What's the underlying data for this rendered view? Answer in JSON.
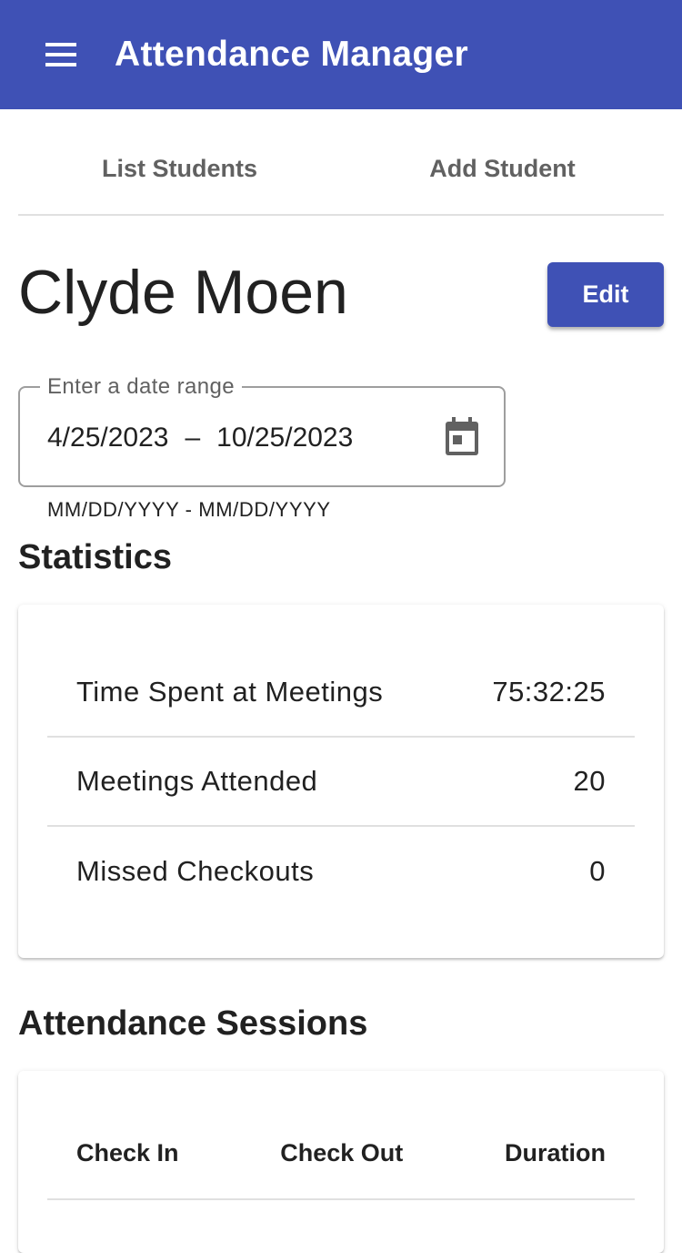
{
  "app": {
    "title": "Attendance Manager",
    "menu_icon": "menu-icon",
    "accent_color": "#3f51b5"
  },
  "tabs": [
    {
      "label": "List Students"
    },
    {
      "label": "Add Student"
    }
  ],
  "student": {
    "name": "Clyde Moen",
    "edit_label": "Edit"
  },
  "date_range": {
    "label": "Enter a date range",
    "start": "4/25/2023",
    "separator": "–",
    "end": "10/25/2023",
    "hint": "MM/DD/YYYY - MM/DD/YYYY",
    "icon": "calendar-icon"
  },
  "statistics": {
    "title": "Statistics",
    "rows": [
      {
        "label": "Time Spent at Meetings",
        "value": "75:32:25"
      },
      {
        "label": "Meetings Attended",
        "value": "20"
      },
      {
        "label": "Missed Checkouts",
        "value": "0"
      }
    ]
  },
  "sessions": {
    "title": "Attendance Sessions",
    "columns": [
      "Check In",
      "Check Out",
      "Duration"
    ]
  }
}
